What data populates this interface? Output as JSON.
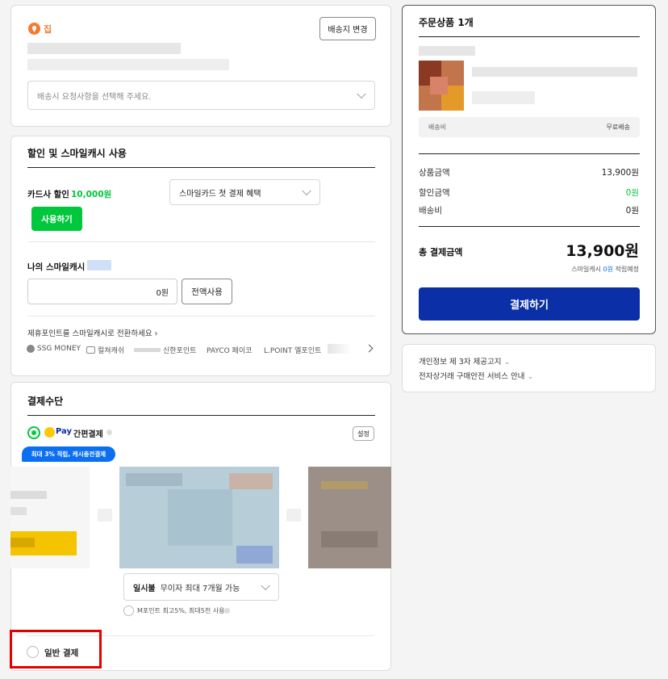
{
  "address": {
    "label": "집",
    "change_button": "배송지 변경",
    "request_placeholder": "배송시 요청사항을 선택해 주세요."
  },
  "discount": {
    "title": "할인 및 스마일캐시 사용",
    "card_discount_label": "카드사 할인",
    "card_discount_amount": "10,000원",
    "card_select": "스마일카드 첫 결제 혜택",
    "use_button": "사용하기",
    "smilecash_label": "나의 스마일캐시",
    "smilecash_input": "0원",
    "use_all_button": "전액사용",
    "convert_link": "제휴포인트를 스마일캐시로 전환하세요",
    "partners": [
      "SSG MONEY",
      "컬쳐캐쉬",
      "신한포인트",
      "PAYCO 페이코",
      "L.POINT 엘포인트"
    ]
  },
  "payment": {
    "title": "결제수단",
    "smilepay_label": "Pay",
    "easy_pay_label": "간편결제",
    "settings_button": "설정",
    "promo_badge": "최대 3% 적립, 캐시충전결제",
    "installment_label": "일시불",
    "installment_note": "무이자 최대 7개월 가능",
    "mpoint_note": "M포인트 최고5%, 최대5천 사용",
    "general_payment": "일반 결제"
  },
  "order": {
    "title": "주문상품 1개",
    "shipping_label": "배송비",
    "shipping_value": "무료배송",
    "product_amount_label": "상품금액",
    "product_amount": "13,900원",
    "discount_label": "할인금액",
    "discount_amount": "0원",
    "delivery_label": "배송비",
    "delivery_amount": "0원",
    "total_label": "총 결제금액",
    "total_amount": "13,900원",
    "cash_reward_prefix": "스마일캐시",
    "cash_reward_value": "0원",
    "cash_reward_suffix": "적립예정",
    "pay_button": "결제하기"
  },
  "footer_links": {
    "privacy": "개인정보 제 3자 제공고지",
    "safety": "전자상거래 구매안전 서비스 안내"
  },
  "colors": {
    "accent_green": "#00c73c",
    "pay_blue": "#0a2fa6",
    "badge_blue": "#0a6ff0",
    "highlight_red": "#e60000",
    "orange": "#f47a30"
  }
}
